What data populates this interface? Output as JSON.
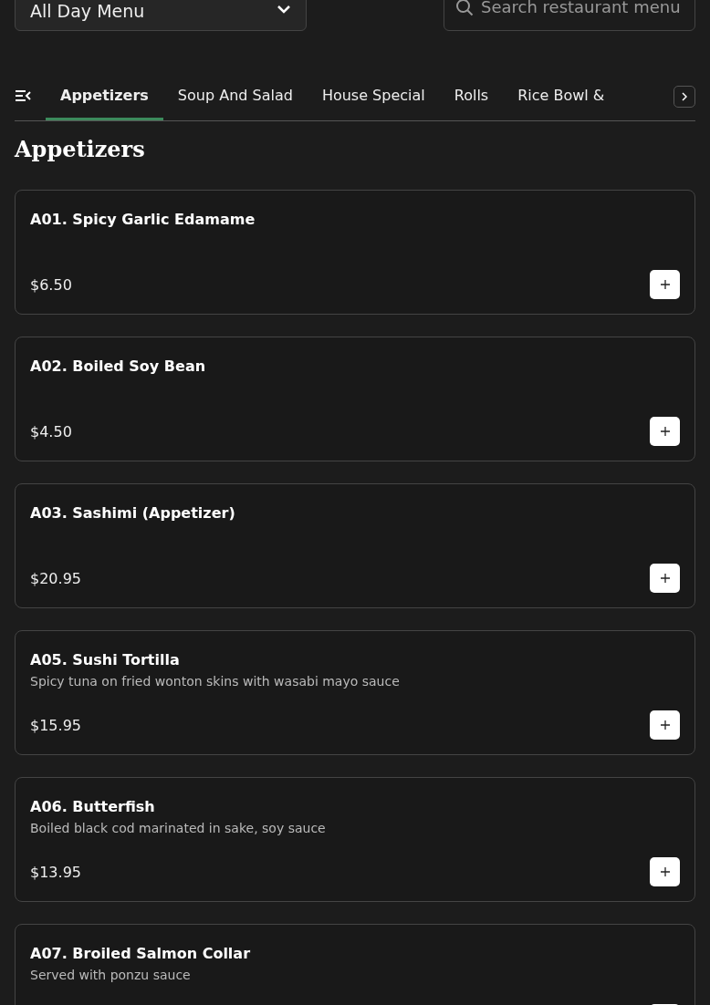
{
  "menu_select": {
    "value": "All Day Menu"
  },
  "search": {
    "placeholder": "Search restaurant menu"
  },
  "tabs": [
    {
      "label": "Appetizers",
      "selected": true
    },
    {
      "label": "Soup And Salad",
      "selected": false
    },
    {
      "label": "House Special",
      "selected": false
    },
    {
      "label": "Rolls",
      "selected": false
    },
    {
      "label": "Rice Bowl &",
      "selected": false
    }
  ],
  "section_title": "Appetizers",
  "items": [
    {
      "name": "A01. Spicy Garlic Edamame",
      "price": "$6.50"
    },
    {
      "name": "A02. Boiled Soy Bean",
      "price": "$4.50"
    },
    {
      "name": "A03. Sashimi (Appetizer)",
      "price": "$20.95"
    },
    {
      "name": "A05. Sushi Tortilla",
      "description": "Spicy tuna on fried wonton skins with wasabi mayo sauce",
      "price": "$15.95"
    },
    {
      "name": "A06. Butterfish",
      "description": "Boiled black cod marinated in sake, soy sauce",
      "price": "$13.95"
    },
    {
      "name": "A07. Broiled Salmon Collar",
      "description": "Served with ponzu sauce"
    }
  ]
}
